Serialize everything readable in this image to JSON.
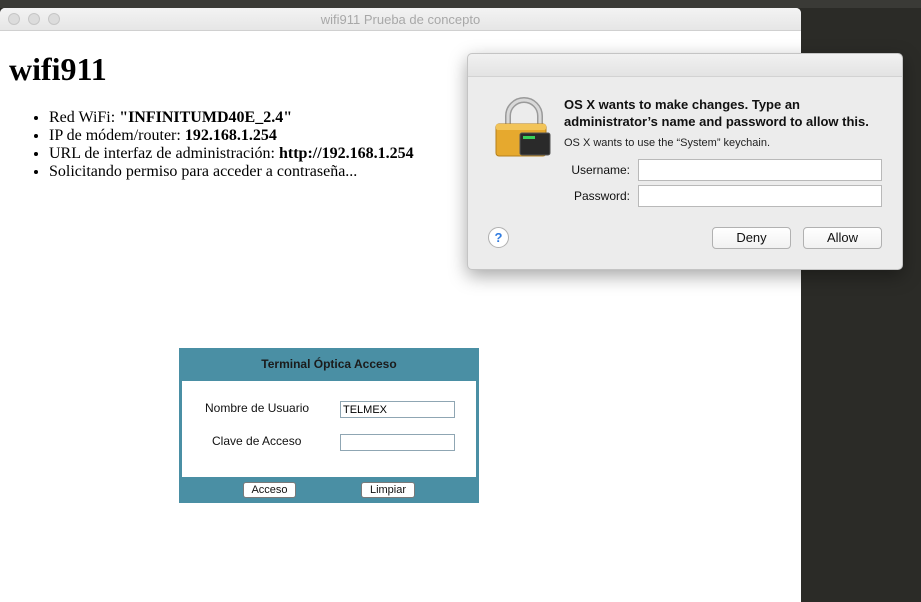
{
  "window": {
    "title": "wifi911 Prueba de concepto"
  },
  "page": {
    "heading": "wifi911",
    "items": [
      {
        "label": "Red WiFi: ",
        "value": "\"INFINITUMD40E_2.4\""
      },
      {
        "label": "IP de módem/router: ",
        "value": "192.168.1.254"
      },
      {
        "label": "URL de interfaz de administración: ",
        "value": "http://192.168.1.254"
      },
      {
        "label": "Solicitando permiso para acceder a contraseña...",
        "value": ""
      }
    ]
  },
  "ont_panel": {
    "title": "Terminal Óptica Acceso",
    "username_label": "Nombre de Usuario",
    "username_value": "TELMEX",
    "password_label": "Clave de Acceso",
    "password_value": "",
    "access_button": "Acceso",
    "clear_button": "Limpiar"
  },
  "auth_dialog": {
    "heading": "OS X wants to make changes. Type an administrator’s name and password to allow this.",
    "subtext": "OS X wants to use the “System” keychain.",
    "username_label": "Username:",
    "username_value": "",
    "password_label": "Password:",
    "password_value": "",
    "help_glyph": "?",
    "deny_button": "Deny",
    "allow_button": "Allow",
    "icon": "lock-icon"
  }
}
